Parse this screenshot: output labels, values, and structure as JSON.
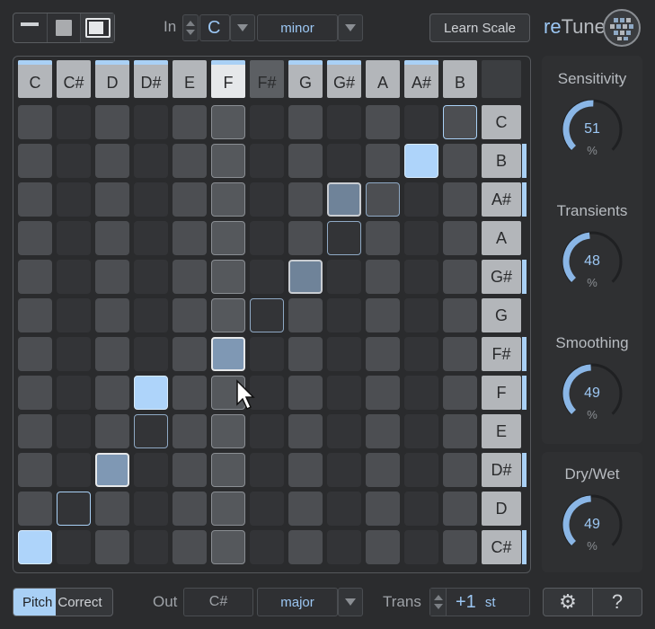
{
  "header": {
    "in_label": "In",
    "key_in": "C",
    "scale_in": "minor",
    "learn_button": "Learn Scale",
    "brand_prefix": "re",
    "brand_suffix": "Tune"
  },
  "grid": {
    "columns": [
      "C",
      "C#",
      "D",
      "D#",
      "E",
      "F",
      "F#",
      "G",
      "G#",
      "A",
      "A#",
      "B"
    ],
    "rows": [
      "C",
      "B",
      "A#",
      "A",
      "G#",
      "G",
      "F#",
      "F",
      "E",
      "D#",
      "D",
      "C#"
    ]
  },
  "knobs": [
    {
      "title": "Sensitivity",
      "value": "51",
      "unit": "%",
      "fraction": 0.51
    },
    {
      "title": "Transients",
      "value": "48",
      "unit": "%",
      "fraction": 0.48
    },
    {
      "title": "Smoothing",
      "value": "49",
      "unit": "%",
      "fraction": 0.49
    },
    {
      "title": "Dry/Wet",
      "value": "49",
      "unit": "%",
      "fraction": 0.49
    }
  ],
  "footer": {
    "pitch": "Pitch",
    "correct": "Correct",
    "out_label": "Out",
    "key_out": "C#",
    "scale_out": "major",
    "trans_label": "Trans",
    "trans_value": "+1",
    "trans_unit": "st",
    "settings_icon": "⚙",
    "help_label": "?"
  },
  "colors": {
    "accent": "#9cc7f4",
    "panel": "#2f3032",
    "background": "#2b2c2e"
  }
}
